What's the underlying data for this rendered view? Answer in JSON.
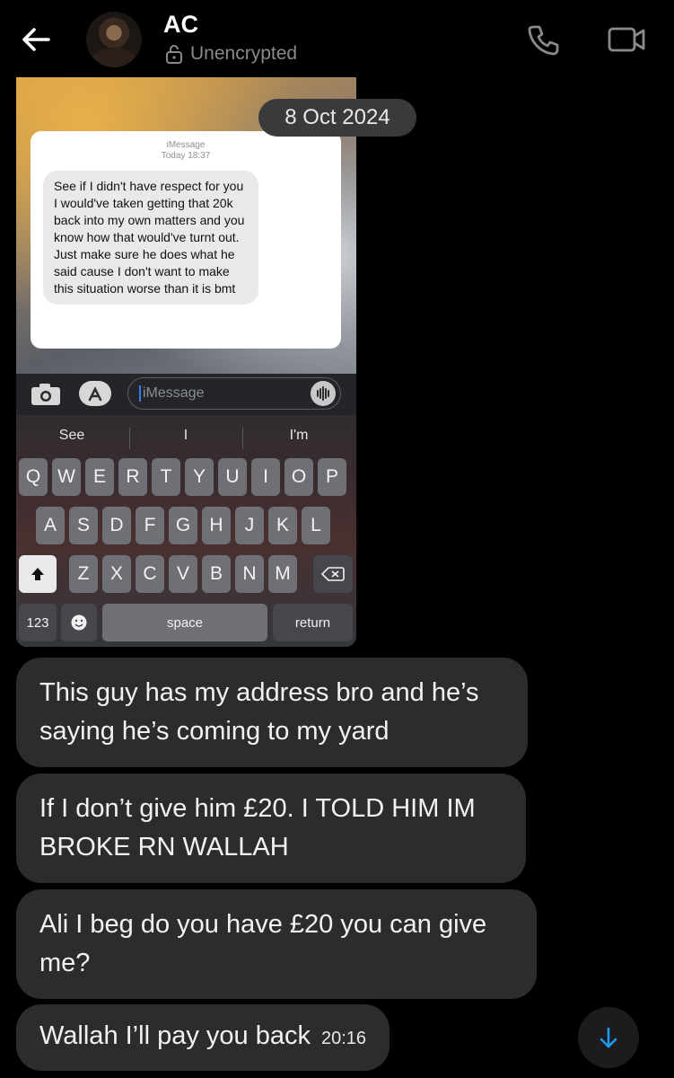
{
  "header": {
    "contact_name": "AC",
    "encryption_status": "Unencrypted",
    "icons": [
      "back-arrow-icon",
      "lock-open-icon",
      "phone-icon",
      "video-camera-icon"
    ]
  },
  "date_separator": "8 Oct 2024",
  "attached_screenshot": {
    "service": "iMessage",
    "timestamp": "Today 18:37",
    "message_text": "See if I didn't have respect for you I would've taken getting that 20k back into my own matters and you know how that would've turnt out. Just make sure he does what he said cause I don't want to make this situation worse than it is bmt",
    "input_placeholder": "iMessage",
    "suggestions": [
      "See",
      "I",
      "I'm"
    ],
    "keyboard_rows": [
      [
        "Q",
        "W",
        "E",
        "R",
        "T",
        "Y",
        "U",
        "I",
        "O",
        "P"
      ],
      [
        "A",
        "S",
        "D",
        "F",
        "G",
        "H",
        "J",
        "K",
        "L"
      ],
      [
        "Z",
        "X",
        "C",
        "V",
        "B",
        "N",
        "M"
      ]
    ],
    "key_123": "123",
    "key_space": "space",
    "key_return": "return"
  },
  "messages": [
    {
      "text": "This guy has my address bro and he’s saying he’s coming to my yard"
    },
    {
      "text": "If I don’t give him £20. I TOLD HIM IM BROKE RN WALLAH"
    },
    {
      "text": "Ali I beg do you have £20 you can give me?"
    },
    {
      "text": "Wallah I’ll pay you back",
      "time": "20:16"
    }
  ],
  "colors": {
    "background": "#000000",
    "bubble": "#2c2c2e",
    "secondary_text": "#8a8a8a",
    "accent": "#3478f6"
  }
}
